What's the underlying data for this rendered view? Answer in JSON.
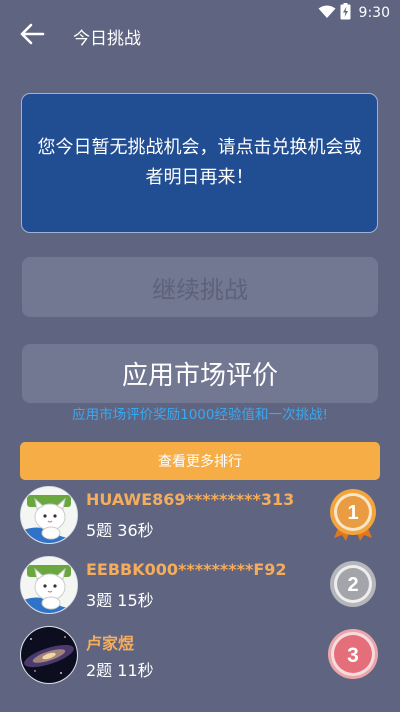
{
  "status_bar": {
    "time": "9:30",
    "icons": [
      "wifi-icon",
      "battery-charging-icon"
    ]
  },
  "app_bar": {
    "title": "今日挑战",
    "back_icon": "arrow-left-icon"
  },
  "notice": {
    "text": "您今日暂无挑战机会，请点击兑换机会或者明日再来！"
  },
  "buttons": {
    "continue_label": "继续挑战",
    "rate_label": "应用市场评价",
    "more_ranking_label": "查看更多排行"
  },
  "reward_hint": "应用市场评价奖励1000经验值和一次挑战!",
  "ranking": [
    {
      "rank": "1",
      "name": "HUAWE869*********313",
      "score": "5题 36秒",
      "avatar": "cartoon-cat-avatar",
      "medal": "gold"
    },
    {
      "rank": "2",
      "name": "EEBBK000*********F92",
      "score": "3题 15秒",
      "avatar": "cartoon-cat-avatar",
      "medal": "silver"
    },
    {
      "rank": "3",
      "name": "卢家煜",
      "score": "2题 11秒",
      "avatar": "galaxy-avatar",
      "medal": "red"
    }
  ],
  "colors": {
    "background": "#5f6480",
    "notice_bg": "#214d92",
    "button_bg": "#727892",
    "accent_orange": "#f7ad45",
    "hint_blue": "#3aa9f0",
    "rank_name": "#f5ad5c"
  }
}
